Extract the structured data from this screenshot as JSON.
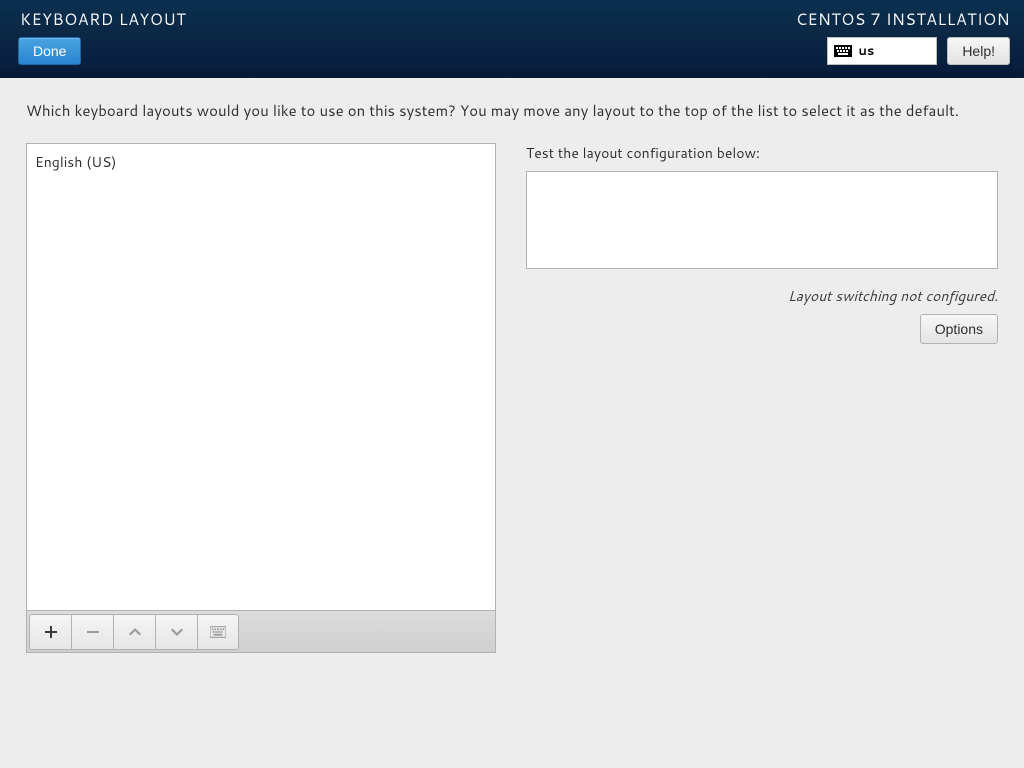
{
  "header": {
    "title": "KEYBOARD LAYOUT",
    "product": "CENTOS 7 INSTALLATION",
    "done_label": "Done",
    "help_label": "Help!",
    "layout_code": "us"
  },
  "instruction": "Which keyboard layouts would you like to use on this system?  You may move any layout to the top of the list to select it as the default.",
  "layouts": [
    {
      "label": "English (US)"
    }
  ],
  "test": {
    "label": "Test the layout configuration below:",
    "value": ""
  },
  "switch_message": "Layout switching not configured.",
  "options_label": "Options"
}
